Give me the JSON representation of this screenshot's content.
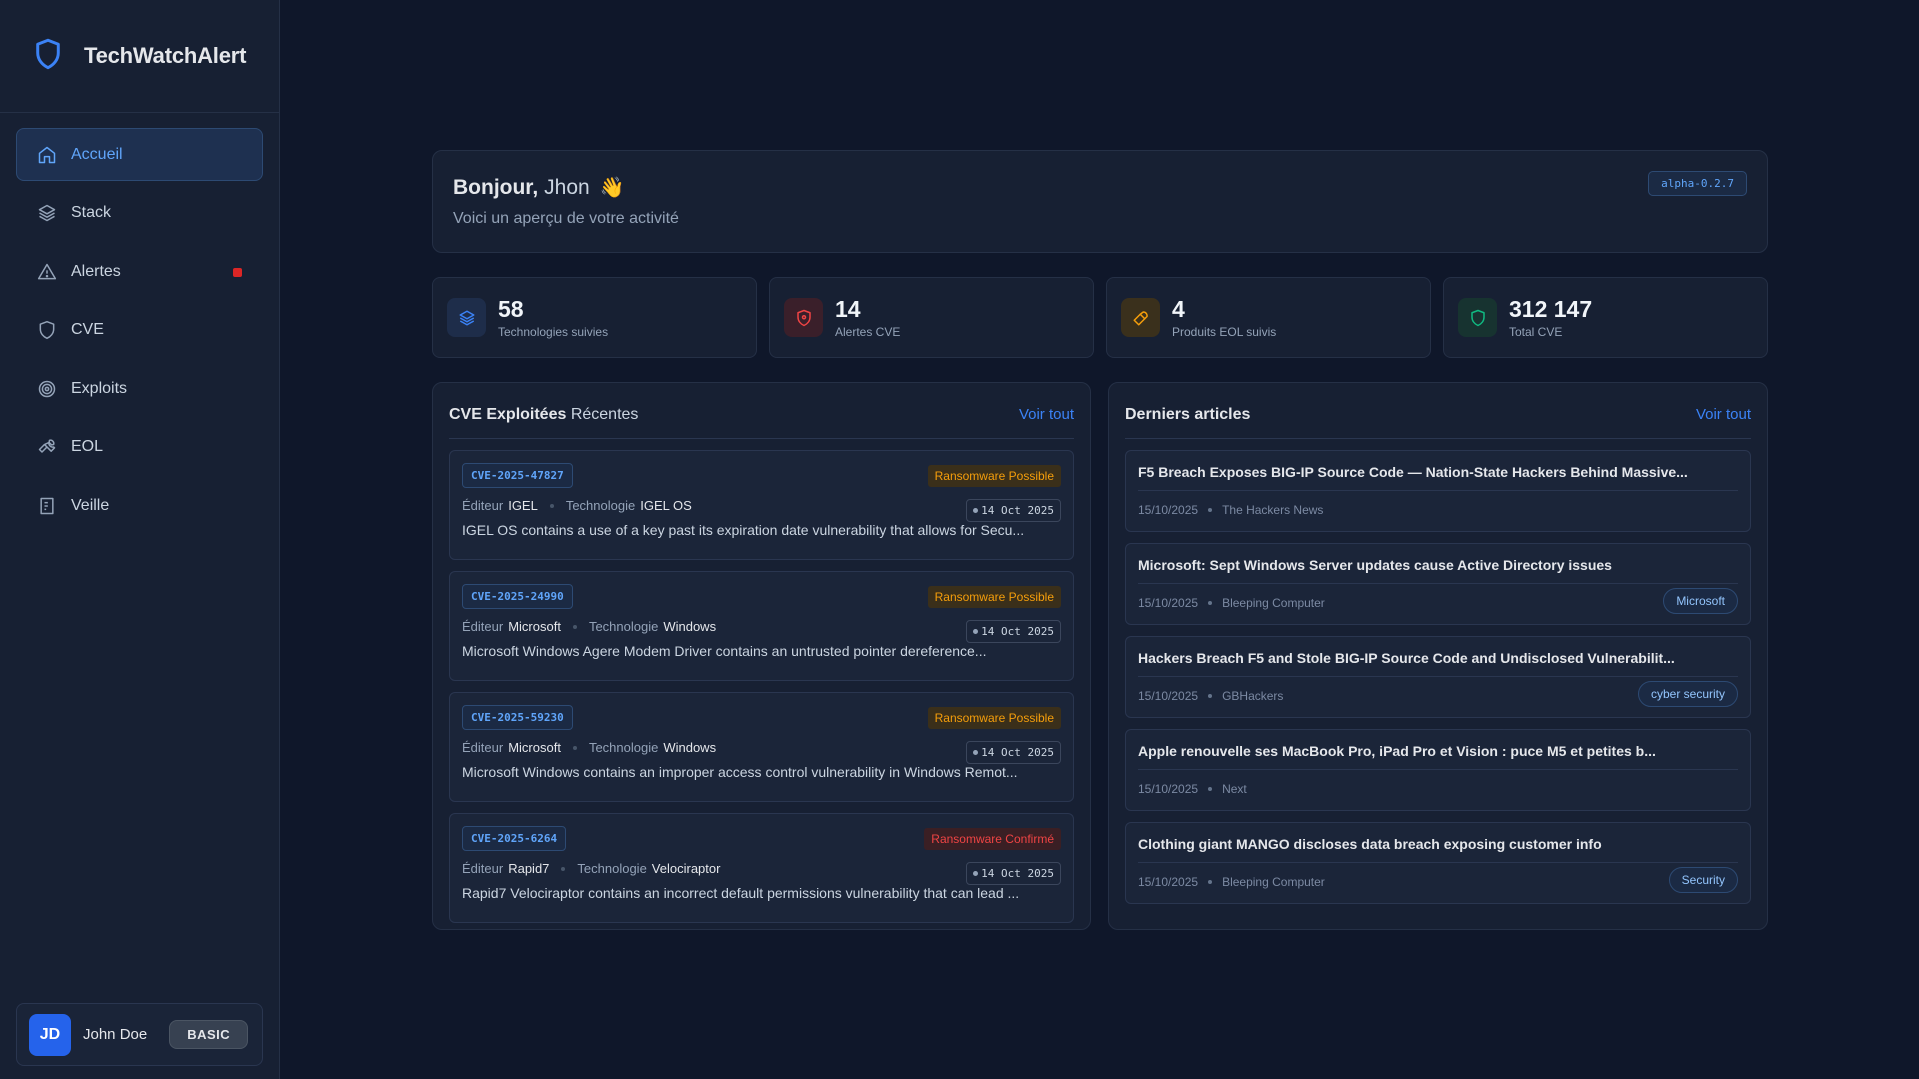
{
  "app": {
    "name": "TechWatchAlert",
    "logo_icon": "shield-icon"
  },
  "sidebar": {
    "items": [
      {
        "label": "Accueil",
        "icon": "home-icon",
        "active": true
      },
      {
        "label": "Stack",
        "icon": "layers-icon"
      },
      {
        "label": "Alertes",
        "icon": "warning-icon",
        "badge_color": "#dc2626"
      },
      {
        "label": "CVE",
        "icon": "shield-icon"
      },
      {
        "label": "Exploits",
        "icon": "target-icon"
      },
      {
        "label": "EOL",
        "icon": "wrench-icon"
      },
      {
        "label": "Veille",
        "icon": "document-icon"
      }
    ],
    "user": {
      "initials": "JD",
      "name": "John Doe",
      "plan": "BASIC"
    }
  },
  "welcome": {
    "greeting": "Bonjour,",
    "name": "Jhon",
    "emoji": "👋",
    "subtitle": "Voici un aperçu de votre activité",
    "version": "alpha-0.2.7"
  },
  "stats": [
    {
      "value": "58",
      "label": "Technologies suivies",
      "icon": "layers-icon",
      "color": "#3b82f6"
    },
    {
      "value": "14",
      "label": "Alertes CVE",
      "icon": "shield-icon",
      "color": "#ef4444"
    },
    {
      "value": "4",
      "label": "Produits EOL suivis",
      "icon": "wrench-icon",
      "color": "#f59e0b"
    },
    {
      "value": "312 147",
      "label": "Total CVE",
      "icon": "shield-icon",
      "color": "#10b981"
    }
  ],
  "cve_panel": {
    "title_main": "CVE Exploitées",
    "title_soft": "Récentes",
    "link": "Voir tout",
    "editor_label": "Éditeur",
    "tech_label": "Technologie",
    "items": [
      {
        "id": "CVE-2025-47827",
        "status": "Ransomware Possible",
        "confirmed": false,
        "editor": "IGEL",
        "tech": "IGEL OS",
        "date": "14 Oct 2025",
        "desc": "IGEL OS contains a use of a key past its expiration date vulnerability that allows for Secu..."
      },
      {
        "id": "CVE-2025-24990",
        "status": "Ransomware Possible",
        "confirmed": false,
        "editor": "Microsoft",
        "tech": "Windows",
        "date": "14 Oct 2025",
        "desc": "Microsoft Windows Agere Modem Driver contains an untrusted pointer dereference..."
      },
      {
        "id": "CVE-2025-59230",
        "status": "Ransomware Possible",
        "confirmed": false,
        "editor": "Microsoft",
        "tech": "Windows",
        "date": "14 Oct 2025",
        "desc": "Microsoft Windows contains an improper access control vulnerability in Windows Remot..."
      },
      {
        "id": "CVE-2025-6264",
        "status": "Ransomware Confirmé",
        "confirmed": true,
        "editor": "Rapid7",
        "tech": "Velociraptor",
        "date": "14 Oct 2025",
        "desc": "Rapid7 Velociraptor contains an incorrect default permissions vulnerability that can lead ..."
      }
    ]
  },
  "articles_panel": {
    "title": "Derniers articles",
    "link": "Voir tout",
    "items": [
      {
        "title": "F5 Breach Exposes BIG-IP Source Code — Nation-State Hackers Behind Massive...",
        "date": "15/10/2025",
        "source": "The Hackers News",
        "tag": ""
      },
      {
        "title": "Microsoft: Sept Windows Server updates cause Active Directory issues",
        "date": "15/10/2025",
        "source": "Bleeping Computer",
        "tag": "Microsoft"
      },
      {
        "title": "Hackers Breach F5 and Stole BIG-IP Source Code and Undisclosed Vulnerabilit...",
        "date": "15/10/2025",
        "source": "GBHackers",
        "tag": "cyber security"
      },
      {
        "title": "Apple renouvelle ses MacBook Pro, iPad Pro et Vision : puce M5 et petites b...",
        "date": "15/10/2025",
        "source": "Next",
        "tag": ""
      },
      {
        "title": "Clothing giant MANGO discloses data breach exposing customer info",
        "date": "15/10/2025",
        "source": "Bleeping Computer",
        "tag": "Security"
      }
    ]
  }
}
